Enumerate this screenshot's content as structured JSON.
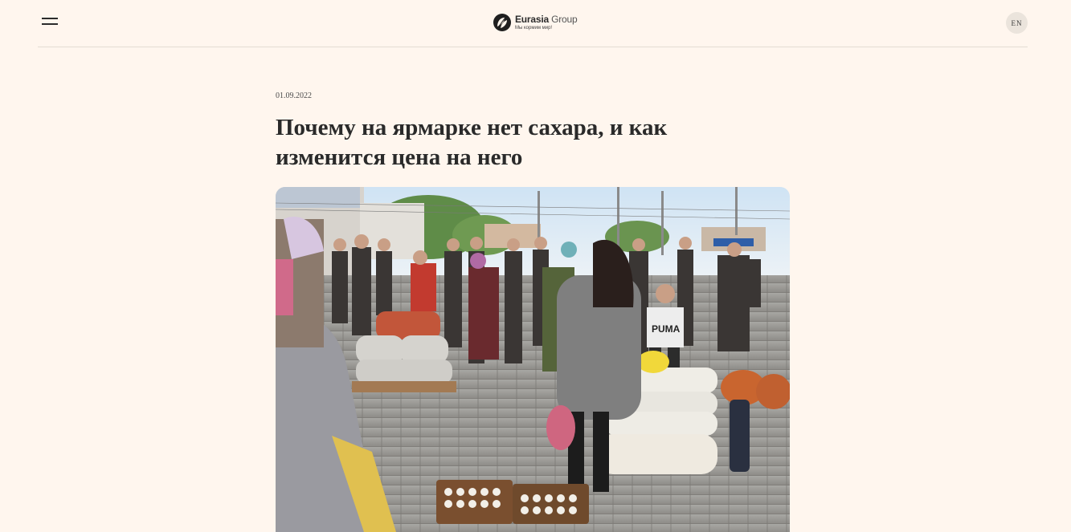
{
  "header": {
    "menu_icon": "hamburger-menu-icon",
    "logo": {
      "icon": "leaf-logo-icon",
      "name_bold": "Eurasia",
      "name_light": "Group",
      "tagline": "Мы кормим мир!"
    },
    "lang_label": "EN"
  },
  "article": {
    "date": "01.09.2022",
    "title": "Почему на ярмарке нет сахара, и как изменится цена на него",
    "hero_image": "market-fair-photo"
  },
  "colors": {
    "background": "#fff6ee",
    "text": "#2b2b2b",
    "divider": "#e3dcd3",
    "lang_badge": "#ebe4dc"
  }
}
